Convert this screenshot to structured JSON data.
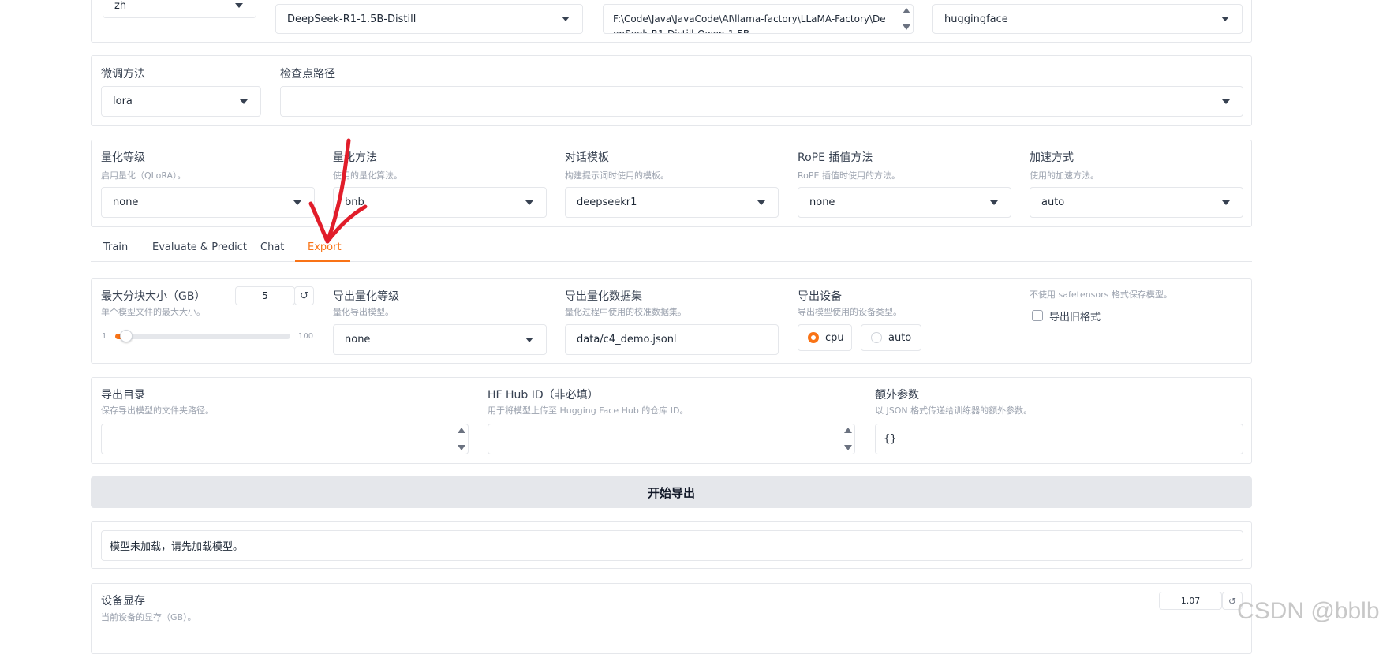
{
  "top_row": {
    "lang_value": "zh",
    "model_value": "DeepSeek-R1-1.5B-Distill",
    "path_value": "F:\\Code\\Java\\JavaCode\\AI\\llama-factory\\LLaMA-Factory\\DeepSeek-R1-Distill-Qwen-1.5B",
    "hub_value": "huggingface"
  },
  "finetune": {
    "method_label": "微调方法",
    "method_value": "lora",
    "checkpoint_label": "检查点路径",
    "checkpoint_value": ""
  },
  "quant_row": {
    "bits_label": "量化等级",
    "bits_sub": "启用量化（QLoRA）。",
    "bits_value": "none",
    "method_label": "量化方法",
    "method_sub": "使用的量化算法。",
    "method_value": "bnb",
    "template_label": "对话模板",
    "template_sub": "构建提示词时使用的模板。",
    "template_value": "deepseekr1",
    "rope_label": "RoPE 插值方法",
    "rope_sub": "RoPE 插值时使用的方法。",
    "rope_value": "none",
    "booster_label": "加速方式",
    "booster_sub": "使用的加速方法。",
    "booster_value": "auto"
  },
  "tabs": [
    "Train",
    "Evaluate & Predict",
    "Chat",
    "Export"
  ],
  "export": {
    "shard_label": "最大分块大小（GB）",
    "shard_sub": "单个模型文件的最大大小。",
    "shard_value": "5",
    "shard_reset": "↺",
    "shard_min": "1",
    "shard_max": "100",
    "quant_bit_label": "导出量化等级",
    "quant_bit_sub": "量化导出模型。",
    "quant_bit_value": "none",
    "dataset_label": "导出量化数据集",
    "dataset_sub": "量化过程中使用的校准数据集。",
    "dataset_value": "data/c4_demo.jsonl",
    "device_label": "导出设备",
    "device_sub": "导出模型使用的设备类型。",
    "device_options": [
      "cpu",
      "auto"
    ],
    "legacy_sub": "不使用 safetensors 格式保存模型。",
    "legacy_label": "导出旧格式",
    "dir_label": "导出目录",
    "dir_sub": "保存导出模型的文件夹路径。",
    "hub_label": "HF Hub ID（非必填）",
    "hub_sub": "用于将模型上传至 Hugging Face Hub 的仓库 ID。",
    "extra_label": "额外参数",
    "extra_sub": "以 JSON 格式传递给训练器的额外参数。",
    "extra_value": "{}",
    "start_button": "开始导出",
    "output_text": "模型未加载，请先加载模型。"
  },
  "memory": {
    "label": "设备显存",
    "sub": "当前设备的显存（GB）。",
    "value": "1.07",
    "reset": "↺"
  },
  "watermark": "CSDN @bblb",
  "colors": {
    "accent": "#f97316",
    "annotation": "#e11d2a"
  },
  "state": {
    "active_tab": "Export",
    "device_selected": "cpu",
    "shard_slider_fraction": 0.04
  }
}
